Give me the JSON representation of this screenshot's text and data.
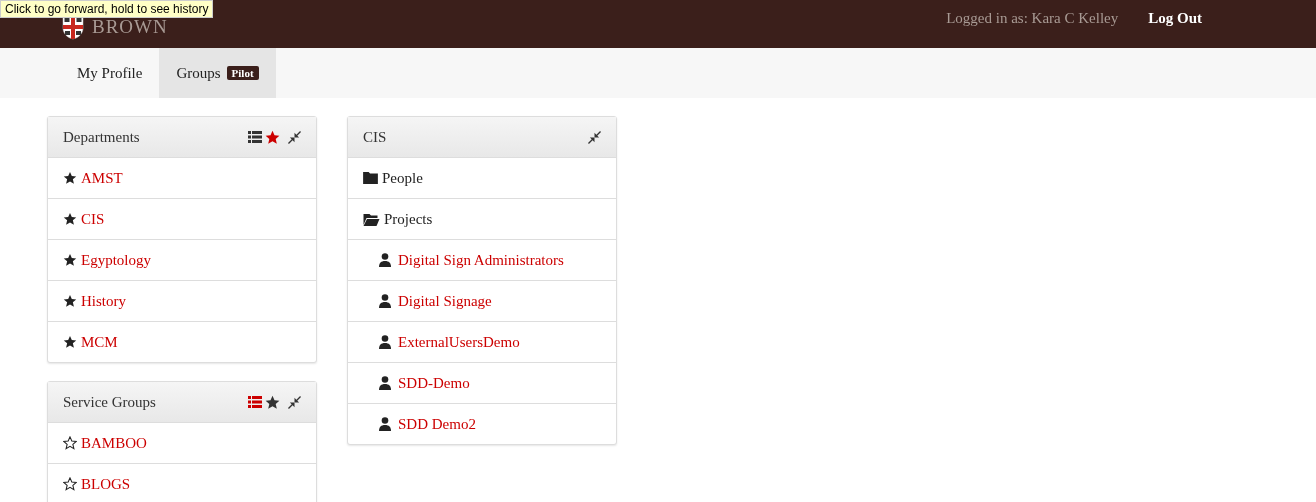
{
  "tooltip": "Click to go forward, hold to see history",
  "header": {
    "logo_text": "BROWN",
    "user": "Logged in as: Kara C Kelley",
    "logout": "Log Out"
  },
  "tabs": [
    {
      "label": "My Profile",
      "selected": false
    },
    {
      "label": "Groups",
      "badge": "Pilot",
      "selected": true
    }
  ],
  "panels": [
    {
      "title": "Departments",
      "list_view": false,
      "starred_view": true,
      "items": [
        {
          "label": "AMST",
          "starred": true
        },
        {
          "label": "CIS",
          "starred": true
        },
        {
          "label": "Egyptology",
          "starred": true
        },
        {
          "label": "History",
          "starred": true
        },
        {
          "label": "MCM",
          "starred": true
        }
      ]
    },
    {
      "title": "Service Groups",
      "list_view": true,
      "starred_view": false,
      "items": [
        {
          "label": "BAMBOO",
          "starred": false
        },
        {
          "label": "BLOGS",
          "starred": false
        }
      ]
    }
  ],
  "detail": {
    "title": "CIS",
    "items": [
      {
        "kind": "folder",
        "label": "People",
        "expanded": false
      },
      {
        "kind": "folder",
        "label": "Projects",
        "expanded": true,
        "children": [
          {
            "kind": "person",
            "label": "Digital Sign Administrators"
          },
          {
            "kind": "person",
            "label": "Digital Signage"
          },
          {
            "kind": "person",
            "label": "ExternalUsersDemo"
          },
          {
            "kind": "person",
            "label": "SDD-Demo"
          },
          {
            "kind": "person",
            "label": "SDD Demo2"
          }
        ]
      }
    ]
  }
}
